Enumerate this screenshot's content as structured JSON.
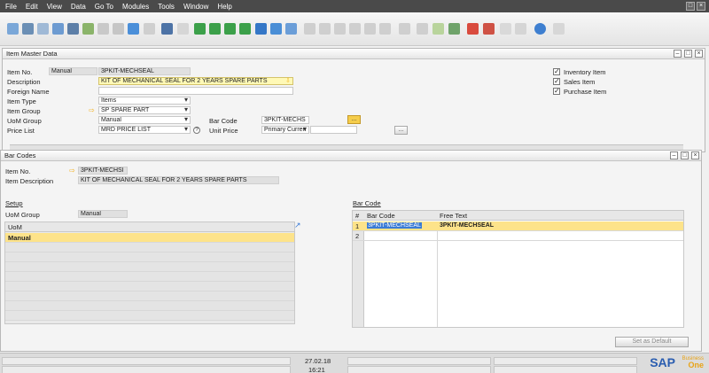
{
  "menu": [
    "File",
    "Edit",
    "View",
    "Data",
    "Go To",
    "Modules",
    "Tools",
    "Window",
    "Help"
  ],
  "item_master": {
    "title": "Item Master Data",
    "item_no_label": "Item No.",
    "item_no_series": "Manual",
    "item_no_value": "3PKIT-MECHSEAL",
    "description_label": "Description",
    "description_value": "KIT OF MECHANICAL SEAL FOR 2 YEARS SPARE PARTS",
    "foreign_name_label": "Foreign Name",
    "item_type_label": "Item Type",
    "item_type_value": "Items",
    "item_group_label": "Item Group",
    "item_group_value": "SP SPARE PART",
    "uom_group_label": "UoM Group",
    "uom_group_value": "Manual",
    "price_list_label": "Price List",
    "price_list_value": "MRD PRICE LIST",
    "bar_code_label": "Bar Code",
    "bar_code_value": "3PKIT-MECHS",
    "unit_price_label": "Unit Price",
    "unit_price_currency": "Primary Curren",
    "inventory_item_label": "Inventory Item",
    "sales_item_label": "Sales Item",
    "purchase_item_label": "Purchase Item",
    "ellipsis": "...",
    "info_glyph": "?"
  },
  "bar_codes": {
    "title": "Bar Codes",
    "item_no_label": "Item No.",
    "item_no_value": "3PKIT-MECHSI",
    "item_desc_label": "Item Description",
    "item_desc_value": "KIT OF MECHANICAL SEAL FOR 2 YEARS SPARE PARTS",
    "setup_label": "Setup",
    "uom_group_label": "UoM Group",
    "uom_group_value": "Manual",
    "uom_header": "UoM",
    "uom_rows": [
      "Manual"
    ],
    "barcode_section_label": "Bar Code",
    "grid_headers": {
      "num": "#",
      "barcode": "Bar Code",
      "freetext": "Free Text"
    },
    "rows": [
      {
        "num": "1",
        "barcode": "3PKIT-MECHSEAL",
        "freetext": "3PKIT-MECHSEAL"
      },
      {
        "num": "2",
        "barcode": "",
        "freetext": ""
      }
    ],
    "set_default_label": "Set as Default"
  },
  "status": {
    "date": "27.02.18",
    "time": "16:21",
    "brand": "SAP",
    "brand_sub1": "Business",
    "brand_sub2": "One"
  },
  "colors": {
    "highlight": "#fde38a",
    "selected": "#f6d57a",
    "accent": "#f3b21e"
  }
}
